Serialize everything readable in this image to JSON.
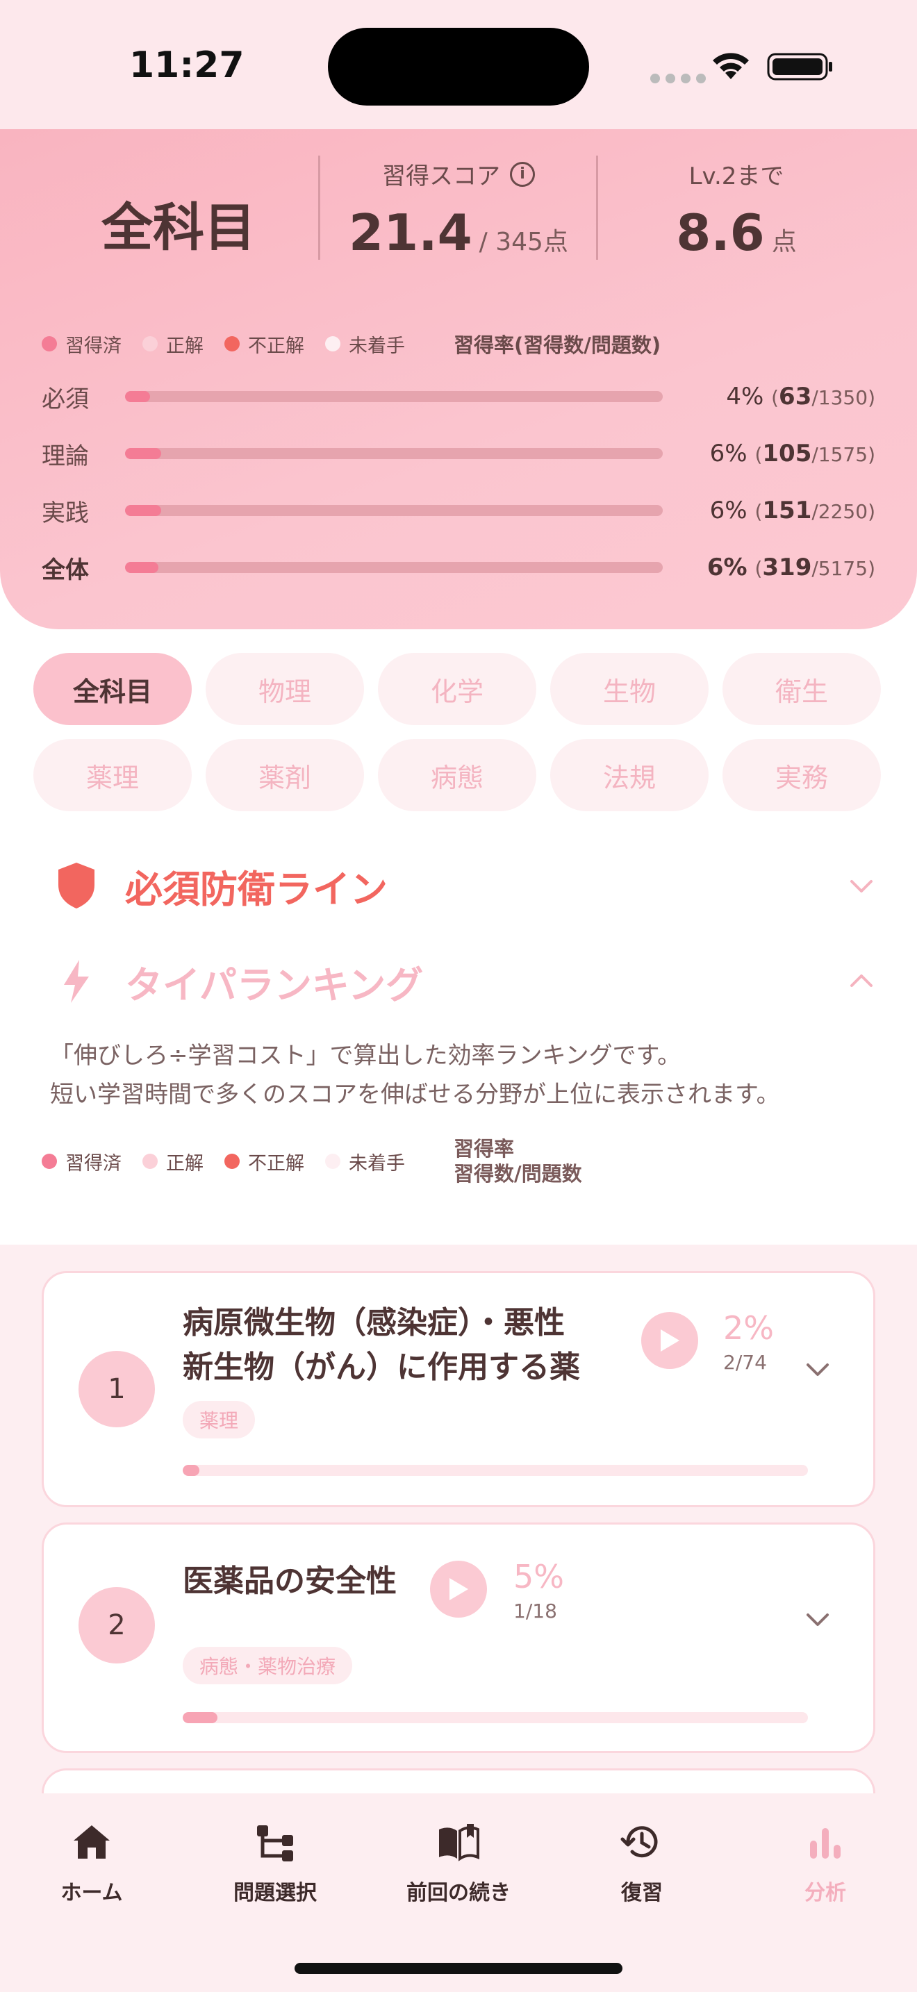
{
  "status_bar": {
    "time": "11:27"
  },
  "summary": {
    "subject": "全科目",
    "score_label": "習得スコア",
    "score_value": "21.4",
    "score_total": "/ 345点",
    "level_label": "Lv.2まで",
    "level_value": "8.6",
    "level_unit": "点",
    "legend": [
      "習得済",
      "正解",
      "不正解",
      "未着手"
    ],
    "rate_title": "習得率(習得数/問題数)",
    "rows": [
      {
        "label": "必須",
        "pct": "4%",
        "done": "63",
        "total": "/1350",
        "fraction": 0.047
      },
      {
        "label": "理論",
        "pct": "6%",
        "done": "105",
        "total": "/1575",
        "fraction": 0.067
      },
      {
        "label": "実践",
        "pct": "6%",
        "done": "151",
        "total": "/2250",
        "fraction": 0.067
      },
      {
        "label": "全体",
        "pct": "6%",
        "done": "319",
        "total": "/5175",
        "fraction": 0.062
      }
    ]
  },
  "colors": {
    "accent": "#f47c95",
    "primary_red": "#f2665f",
    "pink_light": "#f7b7c4"
  },
  "chips": [
    "全科目",
    "物理",
    "化学",
    "生物",
    "衛生",
    "薬理",
    "薬剤",
    "病態",
    "法規",
    "実務"
  ],
  "sections": {
    "defense": {
      "title": "必須防衛ライン",
      "icon": "shield-icon"
    },
    "taipa": {
      "title": "タイパランキング",
      "icon": "lightning-icon",
      "desc_line1": "「伸びしろ÷学習コスト」で算出した効率ランキングです。",
      "desc_line2": "短い学習時間で多くのスコアを伸ばせる分野が上位に表示されます。",
      "legend": [
        "習得済",
        "正解",
        "不正解",
        "未着手"
      ],
      "rate_line1": "習得率",
      "rate_line2": "習得数/問題数"
    }
  },
  "ranking": [
    {
      "rank": "1",
      "title_line1": "病原微生物（感染症）・悪性",
      "title_line2": "新生物（がん）に作用する薬",
      "pct": "2%",
      "count": "2/74",
      "tag": "薬理",
      "fraction": 0.027
    },
    {
      "rank": "2",
      "title_line1": "医薬品の安全性",
      "title_line2": "",
      "pct": "5%",
      "count": "1/18",
      "tag": "病態・薬物治療",
      "fraction": 0.055
    }
  ],
  "nav": [
    {
      "label": "ホーム",
      "icon": "home-icon"
    },
    {
      "label": "問題選択",
      "icon": "tree-icon"
    },
    {
      "label": "前回の続き",
      "icon": "book-icon"
    },
    {
      "label": "復習",
      "icon": "history-icon"
    },
    {
      "label": "分析",
      "icon": "chart-icon"
    }
  ]
}
